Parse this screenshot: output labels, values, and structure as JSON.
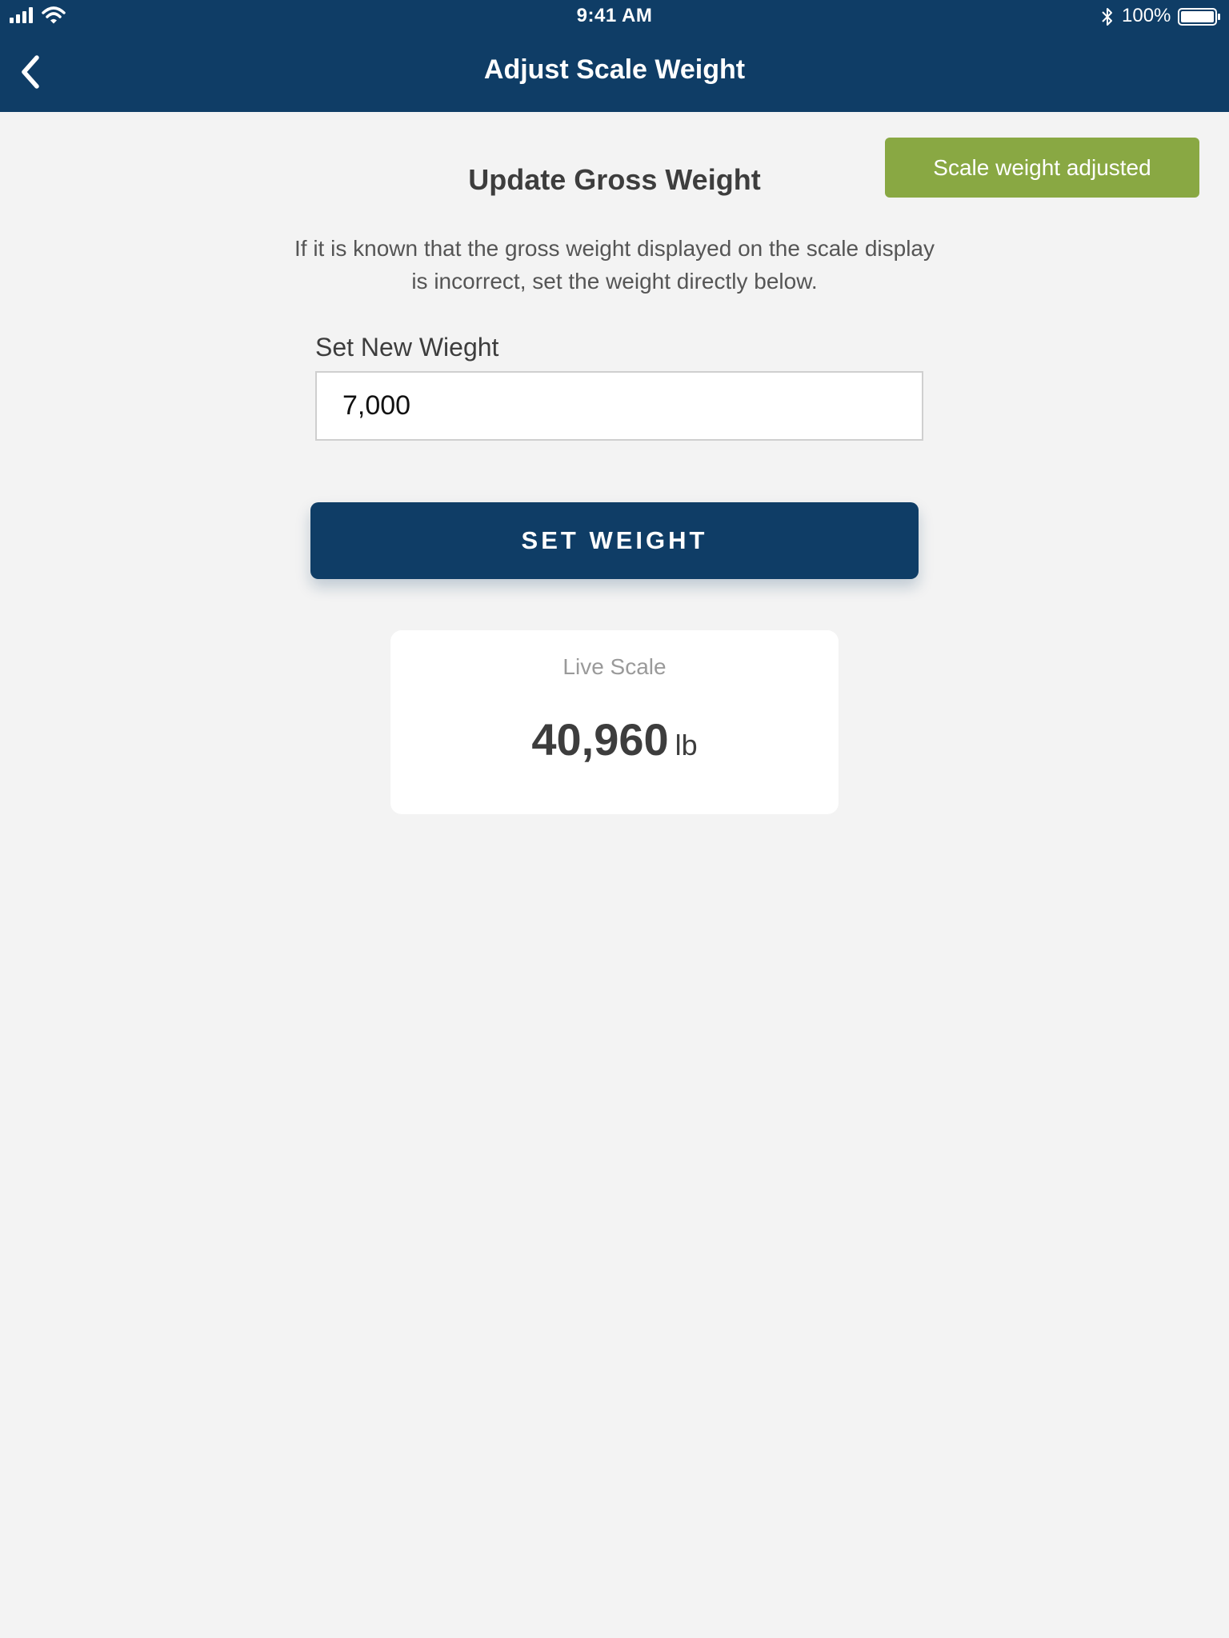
{
  "status_bar": {
    "time": "9:41 AM",
    "battery_percent": "100%",
    "icons": [
      "signal-icon",
      "wifi-icon",
      "bluetooth-icon",
      "battery-icon"
    ]
  },
  "nav": {
    "title": "Adjust Scale Weight",
    "back_icon": "chevron-left-icon"
  },
  "toast": {
    "message": "Scale weight adjusted"
  },
  "form": {
    "title": "Update Gross Weight",
    "description": "If it is known that the gross weight displayed on the scale display is incorrect, set the weight directly below.",
    "field_label": "Set New Wieght",
    "field_value": "7,000",
    "button_label": "SET WEIGHT"
  },
  "live_scale": {
    "label": "Live Scale",
    "value": "40,960",
    "unit": "lb"
  },
  "colors": {
    "header": "#0f3d66",
    "toast": "#89a843",
    "background": "#f3f3f3",
    "button": "#0f3d66"
  }
}
